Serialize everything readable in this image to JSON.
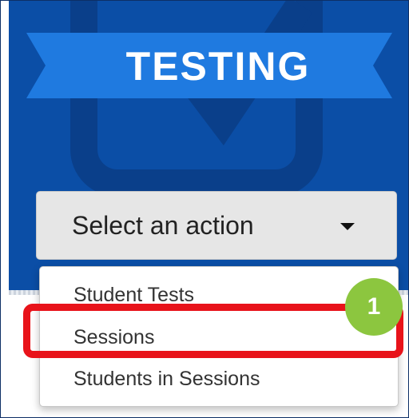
{
  "app": {
    "title": "TESTING"
  },
  "action_select": {
    "label": "Select an action"
  },
  "menu": {
    "items": [
      {
        "label": "Student Tests"
      },
      {
        "label": "Sessions"
      },
      {
        "label": "Students in Sessions"
      }
    ]
  },
  "callout": {
    "number": "1"
  },
  "colors": {
    "panel_blue": "#0b4ea6",
    "ribbon_blue": "#1f7ae0",
    "highlight_red": "#e8131a",
    "badge_green": "#8cc63f"
  }
}
